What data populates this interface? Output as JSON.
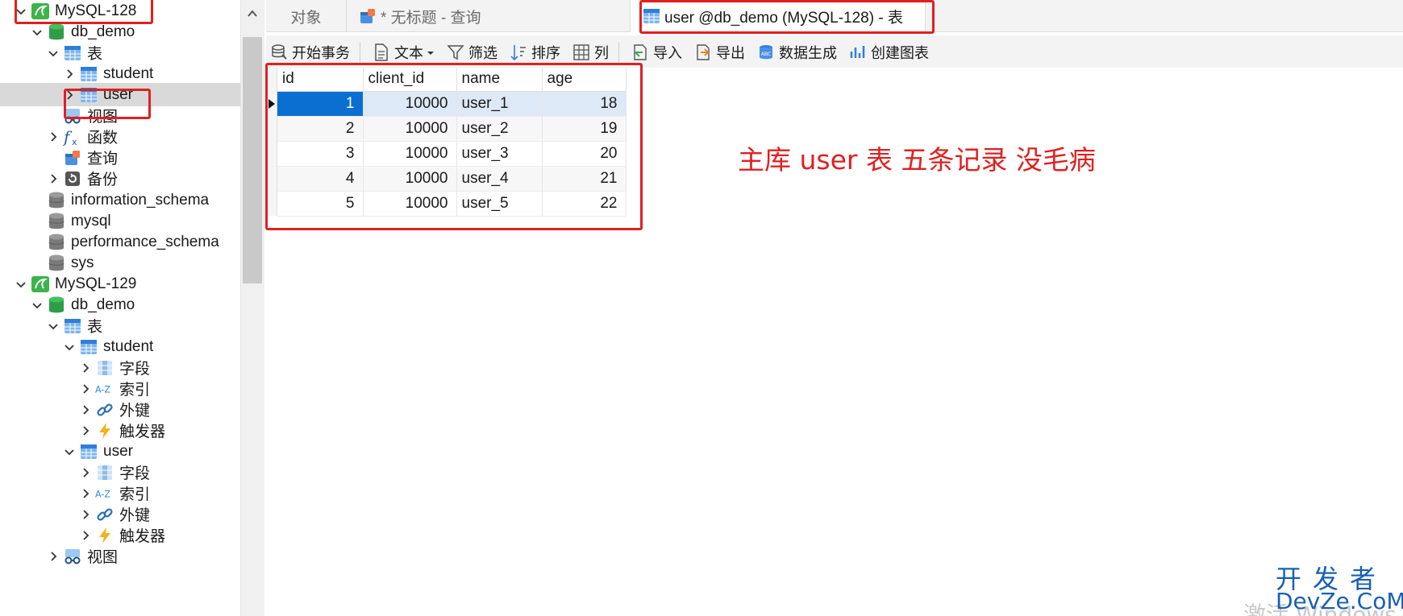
{
  "sidebar": {
    "rows": [
      {
        "label": "MySQL-128",
        "icon": "mysql-connection-icon",
        "expanded": true
      },
      {
        "label": "db_demo",
        "icon": "database-active-icon",
        "expanded": true
      },
      {
        "label": "表",
        "icon": "table-group-icon",
        "expanded": true
      },
      {
        "label": "student",
        "icon": "table-icon",
        "expanded": false
      },
      {
        "label": "user",
        "icon": "table-icon",
        "expanded": false
      },
      {
        "label": "视图",
        "icon": "view-icon"
      },
      {
        "label": "函数",
        "icon": "function-icon",
        "expanded": false
      },
      {
        "label": "查询",
        "icon": "query-icon"
      },
      {
        "label": "备份",
        "icon": "backup-icon",
        "expanded": false
      },
      {
        "label": "information_schema",
        "icon": "database-icon"
      },
      {
        "label": "mysql",
        "icon": "database-icon"
      },
      {
        "label": "performance_schema",
        "icon": "database-icon"
      },
      {
        "label": "sys",
        "icon": "database-icon"
      },
      {
        "label": "MySQL-129",
        "icon": "mysql-connection-icon",
        "expanded": true
      },
      {
        "label": "db_demo",
        "icon": "database-active-icon",
        "expanded": true
      },
      {
        "label": "表",
        "icon": "table-group-icon",
        "expanded": true
      },
      {
        "label": "student",
        "icon": "table-icon",
        "expanded": true
      },
      {
        "label": "字段",
        "icon": "fields-icon",
        "expanded": false
      },
      {
        "label": "索引",
        "icon": "index-icon",
        "expanded": false
      },
      {
        "label": "外键",
        "icon": "foreign-key-icon",
        "expanded": false
      },
      {
        "label": "触发器",
        "icon": "trigger-icon",
        "expanded": false
      },
      {
        "label": "user",
        "icon": "table-icon",
        "expanded": true
      },
      {
        "label": "字段",
        "icon": "fields-icon",
        "expanded": false
      },
      {
        "label": "索引",
        "icon": "index-icon",
        "expanded": false
      },
      {
        "label": "外键",
        "icon": "foreign-key-icon",
        "expanded": false
      },
      {
        "label": "触发器",
        "icon": "trigger-icon",
        "expanded": false
      },
      {
        "label": "视图",
        "icon": "view-icon",
        "expanded": false
      }
    ]
  },
  "tabs": {
    "objects": "对象",
    "query": "* 无标题 - 查询",
    "user_table": "user @db_demo (MySQL-128) - 表"
  },
  "toolbar": {
    "begin_transaction": "开始事务",
    "text": "文本",
    "filter": "筛选",
    "sort": "排序",
    "columns": "列",
    "import": "导入",
    "export": "导出",
    "data_generation": "数据生成",
    "create_chart": "创建图表"
  },
  "grid": {
    "columns": [
      "id",
      "client_id",
      "name",
      "age"
    ],
    "rows": [
      [
        "1",
        "10000",
        "user_1",
        "18"
      ],
      [
        "2",
        "10000",
        "user_2",
        "19"
      ],
      [
        "3",
        "10000",
        "user_3",
        "20"
      ],
      [
        "4",
        "10000",
        "user_4",
        "21"
      ],
      [
        "5",
        "10000",
        "user_5",
        "22"
      ]
    ],
    "selected_row": 0
  },
  "annotation": {
    "note": "主库 user 表 五条记录 没毛病"
  },
  "watermark": {
    "site_cn": "开发者",
    "site_en": "DevZe.CoM",
    "activate": "激活 Windows"
  },
  "colors": {
    "highlight": "#e02020",
    "selection": "#0a6fd1",
    "mysql_green": "#3cb44a",
    "db_green": "#2e9d47",
    "table_blue": "#4a90e2"
  }
}
